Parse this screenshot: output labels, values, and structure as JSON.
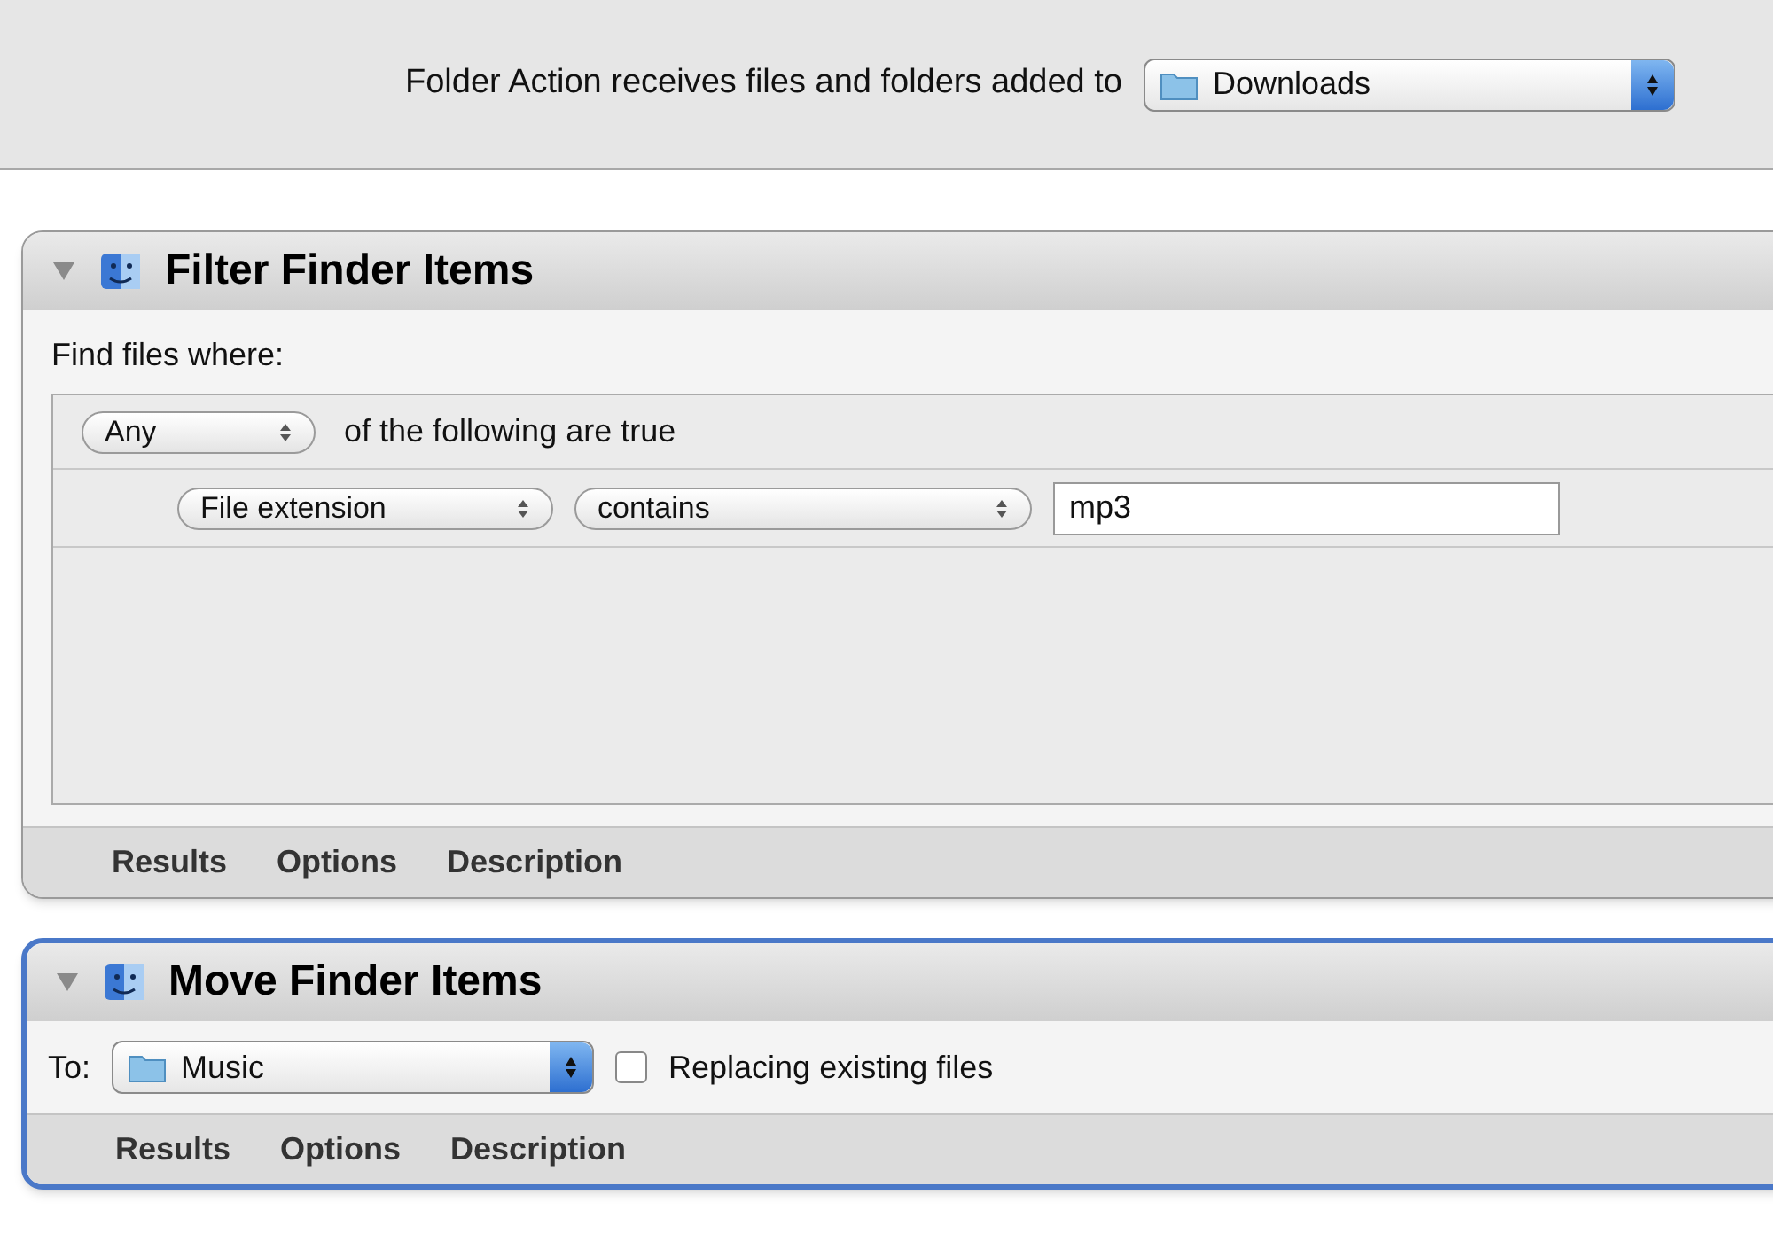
{
  "header": {
    "label": "Folder Action receives files and folders added to",
    "folder_popup": {
      "value": "Downloads"
    }
  },
  "actions": [
    {
      "kind": "filter",
      "title": "Filter Finder Items",
      "selected": false,
      "find_label": "Find files where:",
      "match_popup": "Any",
      "match_text": "of the following are true",
      "rule": {
        "field": "File extension",
        "operator": "contains",
        "value": "mp3"
      },
      "footer_tabs": [
        "Results",
        "Options",
        "Description"
      ]
    },
    {
      "kind": "move",
      "title": "Move Finder Items",
      "selected": true,
      "to_label": "To:",
      "destination": "Music",
      "replacing": {
        "label": "Replacing existing files",
        "checked": false
      },
      "footer_tabs": [
        "Results",
        "Options",
        "Description"
      ]
    }
  ]
}
